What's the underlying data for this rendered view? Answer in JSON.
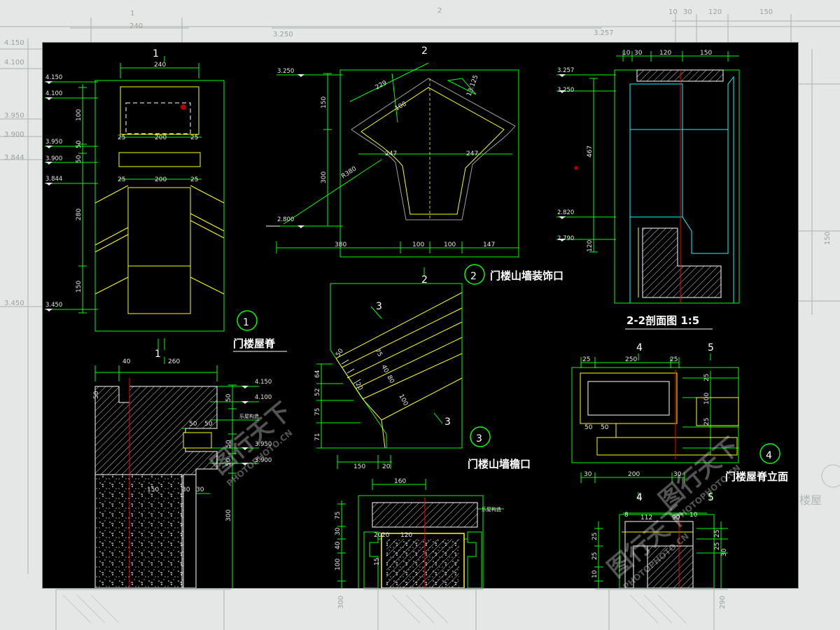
{
  "colors": {
    "background": "#000000",
    "outer_sheet": "#e4e7e5",
    "outline_green": "#00ff00",
    "detail_yellow": "#ffff00",
    "centerline_red": "#ff0000",
    "cyan": "#00ffff",
    "text_white": "#ffffff"
  },
  "sheet_bg": {
    "dims": [
      "1",
      "240",
      "2",
      "3.250",
      "3.257",
      "10",
      "30",
      "120",
      "150",
      "4.150",
      "4.100",
      "3.950",
      "3.900",
      "3.844",
      "3.450",
      "150",
      "300",
      "290"
    ],
    "labels": [
      "楼屋"
    ]
  },
  "detail1": {
    "section_mark": "1",
    "dims_top": [
      "240",
      "25",
      "200",
      "25",
      "25",
      "200",
      "25"
    ],
    "levels": [
      "4.150",
      "4.100",
      "3.950",
      "3.900",
      "3.844",
      "3.450"
    ],
    "dims_side": [
      "100",
      "50",
      "50",
      "280",
      "150"
    ],
    "circle_number": "1",
    "title": "门楼屋脊"
  },
  "detail2": {
    "section_mark": "2",
    "levels": [
      "3.250",
      "2.800"
    ],
    "dims": [
      "229",
      "13.125",
      "100",
      "247",
      "247",
      "R380",
      "150",
      "300",
      "380",
      "100",
      "100",
      "147"
    ],
    "circle_number": "2",
    "title": "门楼山墙装饰口"
  },
  "section22": {
    "dims_top": [
      "10",
      "30",
      "120",
      "150"
    ],
    "levels": [
      "3.257",
      "3.250",
      "2.820",
      "2.790"
    ],
    "dims_side": [
      "467",
      "120"
    ],
    "title": "2-2剖面图 1:5"
  },
  "detail3": {
    "section_mark": "2",
    "marks": [
      "3",
      "3"
    ],
    "dims": [
      "50",
      "64",
      "52",
      "75",
      "71",
      "75",
      "40",
      "80",
      "20",
      "100",
      "150",
      "20"
    ],
    "circle_number": "3",
    "title": "门楼山墙檐口"
  },
  "detail_left_bottom": {
    "section_mark": "1",
    "dims": [
      "40",
      "260",
      "50",
      "50",
      "50",
      "150",
      "30",
      "30",
      "50",
      "50",
      "50",
      "300"
    ],
    "levels": [
      "4.150",
      "4.100",
      "3.950",
      "3.900"
    ],
    "note": "乐屋构造"
  },
  "detail_mid_bottom": {
    "dims": [
      "160",
      "20",
      "20",
      "120",
      "75",
      "30",
      "40",
      "100",
      "15"
    ],
    "note": "乐屋构造"
  },
  "detail4": {
    "section_marks": [
      "4",
      "5",
      "4",
      "5"
    ],
    "dims": [
      "25",
      "250",
      "25",
      "25",
      "100",
      "25",
      "50",
      "50",
      "30",
      "200",
      "30"
    ],
    "circle_number": "4",
    "title": "门楼屋脊立面"
  },
  "detail_right_bottom": {
    "dims": [
      "8",
      "112",
      "90",
      "10",
      "25",
      "25",
      "10",
      "25",
      "25",
      "30"
    ]
  },
  "watermarks": [
    {
      "brand": "图行天下",
      "url": "PHOTOPHOTO.CN"
    },
    {
      "brand": "图行天下",
      "url": "PHOTOPHOTO.CN"
    },
    {
      "brand": "图行天下",
      "url": "PHOTOPHOTO.CN"
    }
  ]
}
